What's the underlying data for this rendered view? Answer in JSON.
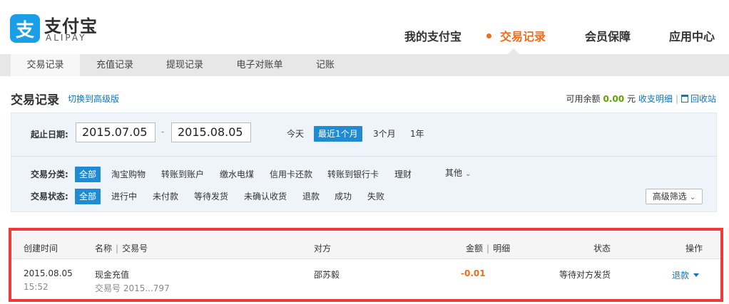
{
  "brand": {
    "icon_glyph": "支",
    "name_cn": "支付宝",
    "name_en": "ALIPAY",
    "color": "#1a9fe6"
  },
  "topnav": [
    {
      "label": "我的支付宝"
    },
    {
      "label": "交易记录",
      "active": true
    },
    {
      "label": "会员保障"
    },
    {
      "label": "应用中心"
    }
  ],
  "subnav": [
    {
      "label": "交易记录",
      "active": true
    },
    {
      "label": "充值记录"
    },
    {
      "label": "提现记录"
    },
    {
      "label": "电子对账单"
    },
    {
      "label": "记账"
    }
  ],
  "page": {
    "title": "交易记录",
    "switch_link": "切换到高级版",
    "balance_label": "可用余额",
    "balance_amount": "0.00",
    "balance_unit": "元",
    "detail_link": "收支明细",
    "recycle_link": "回收站"
  },
  "filter": {
    "date_label": "起止日期:",
    "start_date": "2015.07.05",
    "end_date": "2015.08.05",
    "ranges": [
      "今天",
      "最近1个月",
      "3个月",
      "1年"
    ],
    "active_range": "最近1个月",
    "category_label": "交易分类:",
    "categories": [
      "全部",
      "淘宝购物",
      "转账到账户",
      "缴水电煤",
      "信用卡还款",
      "转账到银行卡",
      "理财"
    ],
    "category_more": "其他",
    "status_label": "交易状态:",
    "statuses": [
      "全部",
      "进行中",
      "未付款",
      "等待发货",
      "未确认收货",
      "退款",
      "成功",
      "失败"
    ],
    "advanced_filter": "高级筛选"
  },
  "table": {
    "headers": {
      "created": "创建时间",
      "name": "名称",
      "trade_no": "交易号",
      "counterparty": "对方",
      "amount": "金额",
      "detail": "明细",
      "status": "状态",
      "action": "操作"
    },
    "rows": [
      {
        "date": "2015.08.05",
        "time": "15:52",
        "name": "现金充值",
        "trade_no": "交易号 2015...797",
        "counterparty": "邵苏毅",
        "amount": "-0.01",
        "status": "等待对方发货",
        "action": "退款"
      }
    ]
  },
  "colors": {
    "accent": "#ef6c1a",
    "link": "#0a76c4",
    "active_chip": "#1e8bd3",
    "positive": "#5fa300",
    "highlight": "#ef3a3a"
  }
}
